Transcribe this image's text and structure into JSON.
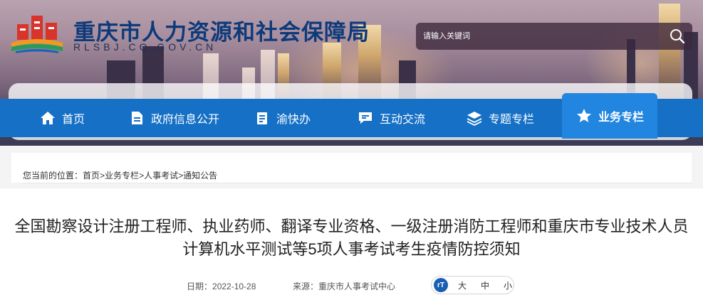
{
  "header": {
    "site_title": "重庆市人力资源和社会保障局",
    "site_domain": "RLSBJ.CQ.GOV.CN",
    "search_placeholder": "请输入关键词"
  },
  "nav": {
    "items": [
      {
        "label": "首页",
        "icon": "home-icon"
      },
      {
        "label": "政府信息公开",
        "icon": "document-icon"
      },
      {
        "label": "渝快办",
        "icon": "clipboard-icon"
      },
      {
        "label": "互动交流",
        "icon": "chat-icon"
      },
      {
        "label": "专题专栏",
        "icon": "layers-icon"
      },
      {
        "label": "业务专栏",
        "icon": "star-icon",
        "active": true
      }
    ]
  },
  "breadcrumb": {
    "prefix": "您当前的位置：",
    "items": [
      "首页",
      "业务专栏",
      "人事考试",
      "通知公告"
    ],
    "separator": ">"
  },
  "article": {
    "title": "全国勘察设计注册工程师、执业药师、翻译专业资格、一级注册消防工程师和重庆市专业技术人员计算机水平测试等5项人事考试考生疫情防控须知",
    "date_label": "日期：",
    "date": "2022-10-28",
    "source_label": "来源：",
    "source": "重庆市人事考试中心",
    "font_sizes": [
      "大",
      "中",
      "小"
    ]
  },
  "colors": {
    "nav_bg": "#1570c6",
    "nav_active": "#2285e0",
    "title_blue": "#0d3a7a"
  }
}
